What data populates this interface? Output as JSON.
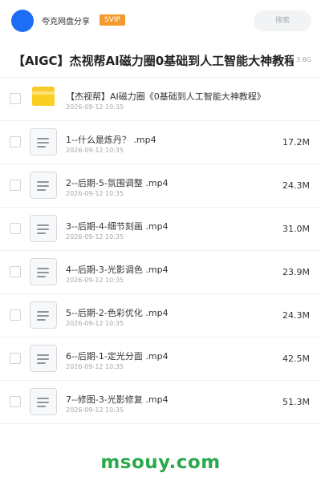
{
  "header": {
    "app_name": "夸克网盘分享",
    "badge": "SVIP",
    "search_placeholder": "搜索"
  },
  "share": {
    "title": "【AIGC】杰视帮AI磁力圈0基础到人工智能大神教程",
    "total_size": "3.6G"
  },
  "files": [
    {
      "type": "folder",
      "name": "【杰视帮】AI磁力圈《0基础到人工智能大神教程》",
      "date": "2026-09-12 10:35",
      "size": ""
    },
    {
      "type": "file",
      "name": "1--什么是炼丹？ .mp4",
      "date": "2026-09-12 10:35",
      "size": "17.2M"
    },
    {
      "type": "file",
      "name": "2--后期-5-氛围调整 .mp4",
      "date": "2026-09-12 10:35",
      "size": "24.3M"
    },
    {
      "type": "file",
      "name": "3--后期-4-细节刻画 .mp4",
      "date": "2026-09-12 10:35",
      "size": "31.0M"
    },
    {
      "type": "file",
      "name": "4--后期-3-光影调色 .mp4",
      "date": "2026-09-12 10:35",
      "size": "23.9M"
    },
    {
      "type": "file",
      "name": "5--后期-2-色彩优化 .mp4",
      "date": "2026-09-12 10:35",
      "size": "24.3M"
    },
    {
      "type": "file",
      "name": "6--后期-1-定光分面 .mp4",
      "date": "2026-09-12 10:35",
      "size": "42.5M"
    },
    {
      "type": "file",
      "name": "7--修图-3-光影修复 .mp4",
      "date": "2026-09-12 10:35",
      "size": "51.3M"
    }
  ],
  "footer": {
    "logo_text": "msouy.com"
  },
  "colors": {
    "avatar": "#1e6ef5",
    "badge": "#f29a2e",
    "folder": "#fbcf21",
    "logo": "#2aa84a"
  }
}
